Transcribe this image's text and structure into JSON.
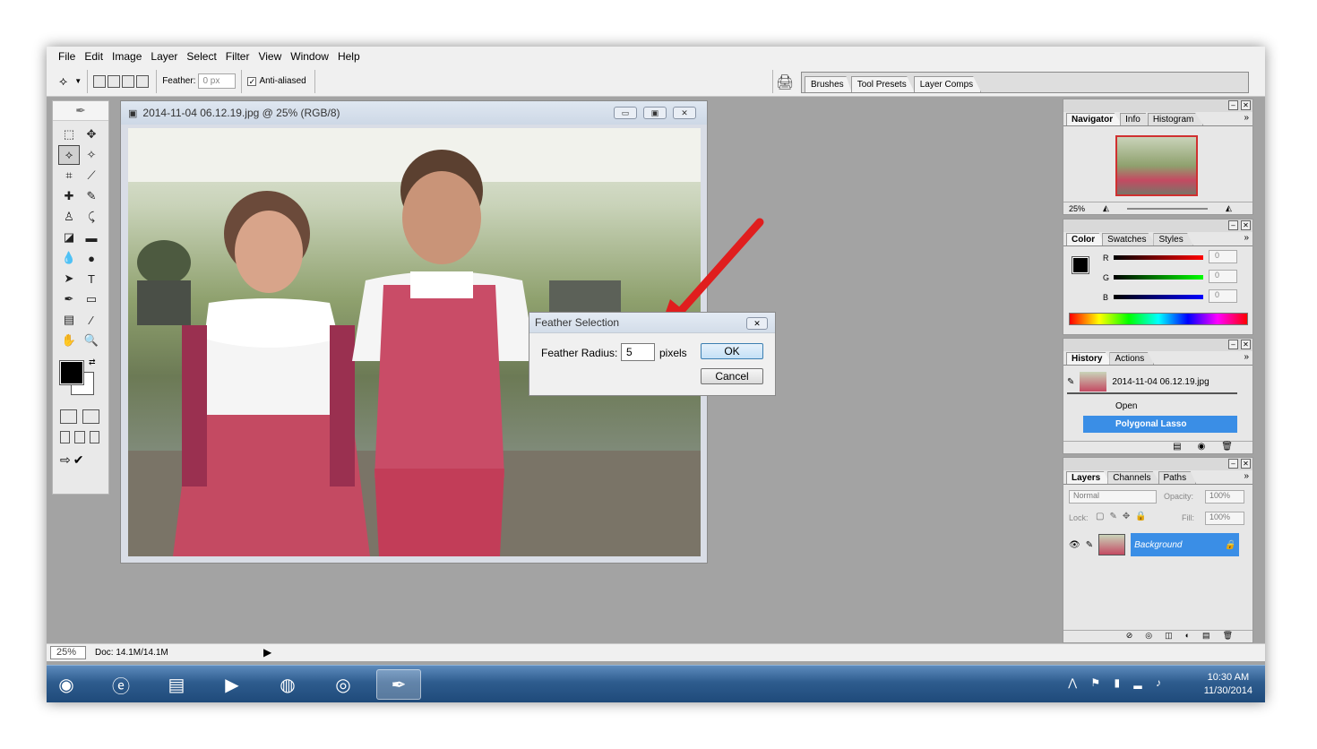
{
  "menubar": {
    "items": [
      "File",
      "Edit",
      "Image",
      "Layer",
      "Select",
      "Filter",
      "View",
      "Window",
      "Help"
    ]
  },
  "options": {
    "feather_label": "Feather:",
    "feather_value": "0 px",
    "antialias_label": "Anti-aliased",
    "antialias_checked": true
  },
  "wells": {
    "tabs": [
      "Brushes",
      "Tool Presets",
      "Layer Comps"
    ]
  },
  "document": {
    "title": "2014-11-04 06.12.19.jpg @ 25% (RGB/8)",
    "btn_min": "▭",
    "btn_max": "▣",
    "btn_close": "✕"
  },
  "dialog": {
    "title": "Feather Selection",
    "radius_label": "Feather Radius:",
    "radius_value": "5",
    "unit": "pixels",
    "ok": "OK",
    "cancel": "Cancel"
  },
  "navigator": {
    "tabs": [
      "Navigator",
      "Info",
      "Histogram"
    ],
    "zoom": "25%"
  },
  "color": {
    "tabs": [
      "Color",
      "Swatches",
      "Styles"
    ],
    "r_label": "R",
    "g_label": "G",
    "b_label": "B",
    "r": "0",
    "g": "0",
    "b": "0",
    "foreground": "#000000"
  },
  "history": {
    "tabs": [
      "History",
      "Actions"
    ],
    "snapshot": "2014-11-04 06.12.19.jpg",
    "steps": [
      "Open",
      "Polygonal Lasso"
    ]
  },
  "layers": {
    "tabs": [
      "Layers",
      "Channels",
      "Paths"
    ],
    "blend": "Normal",
    "opacity_label": "Opacity:",
    "opacity": "100%",
    "lock_label": "Lock:",
    "fill_label": "Fill:",
    "fill": "100%",
    "layer_name": "Background"
  },
  "status": {
    "zoom": "25%",
    "doc": "Doc: 14.1M/14.1M"
  },
  "taskbar": {
    "time": "10:30 AM",
    "date": "11/30/2014"
  },
  "colors": {
    "accent": "#3399ff",
    "highlight_row": "#3a8ee6",
    "arrow": "#e01e1e"
  }
}
